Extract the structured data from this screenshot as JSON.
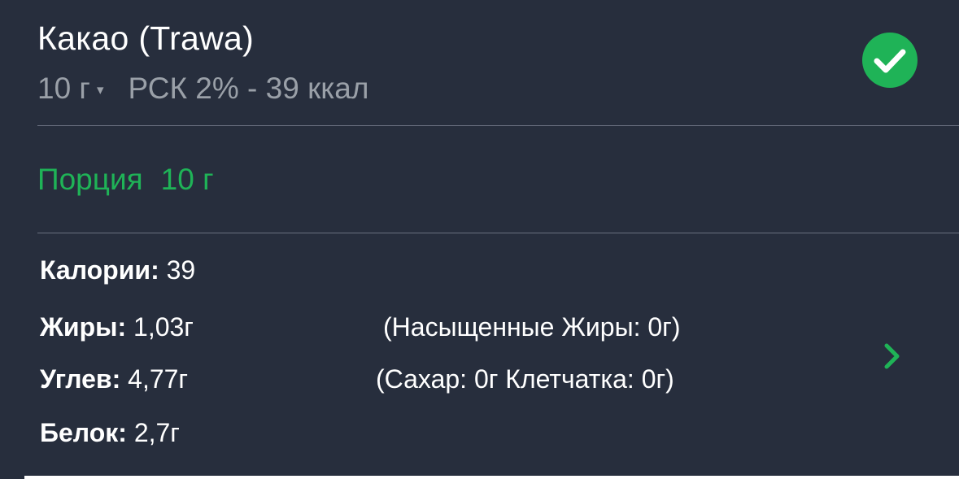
{
  "food": {
    "title": "Какао (Trawa)",
    "portion_value": "10 г",
    "portion_caret": "▾",
    "summary": "РСК 2% - 39 ккал"
  },
  "portion": {
    "label": "Порция",
    "value": "10 г"
  },
  "nutrients": {
    "calories_label": "Калории:",
    "calories_value": "39",
    "fat_label": "Жиры:",
    "fat_value": "1,03г",
    "saturated_fat": "(Насыщенные Жиры: 0г)",
    "carbs_label": "Углев:",
    "carbs_value": "4,77г",
    "sugar_fiber": "(Сахар: 0г Клетчатка: 0г)",
    "protein_label": "Белок:",
    "protein_value": "2,7г"
  },
  "icons": {
    "confirm": "check-circle-icon",
    "details": "chevron-right-icon"
  },
  "colors": {
    "background": "#272e3d",
    "accent_green": "#1fb357",
    "secondary_text": "#9aa0a8",
    "primary_text": "#ffffff"
  }
}
